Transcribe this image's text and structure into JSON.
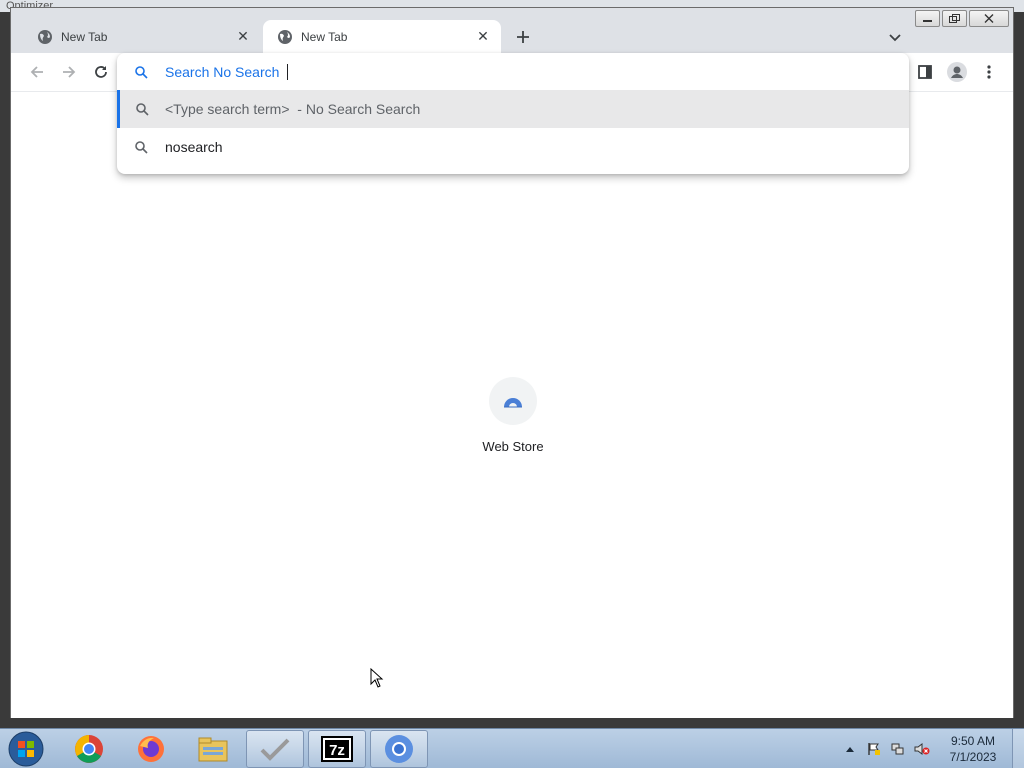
{
  "background_window": {
    "title": "Optimizer"
  },
  "tabs": [
    {
      "title": "New Tab",
      "active": false
    },
    {
      "title": "New Tab",
      "active": true
    }
  ],
  "omnibox": {
    "input_value": "Search No Search",
    "suggestions": [
      {
        "text": "<Type search term>  - No Search Search",
        "selected": true
      },
      {
        "text": "nosearch",
        "selected": false
      }
    ]
  },
  "shortcuts": [
    {
      "label": "Web Store"
    }
  ],
  "taskbar": {
    "apps": [
      "chrome-icon",
      "firefox-icon",
      "file-explorer-icon",
      "checkmark-app-icon",
      "7zip-icon",
      "chromium-icon"
    ],
    "clock": {
      "time": "9:50 AM",
      "date": "7/1/2023"
    }
  },
  "colors": {
    "accent": "#1a73e8",
    "tab_strip": "#dee1e6",
    "taskbar": "#a9c1dc"
  }
}
